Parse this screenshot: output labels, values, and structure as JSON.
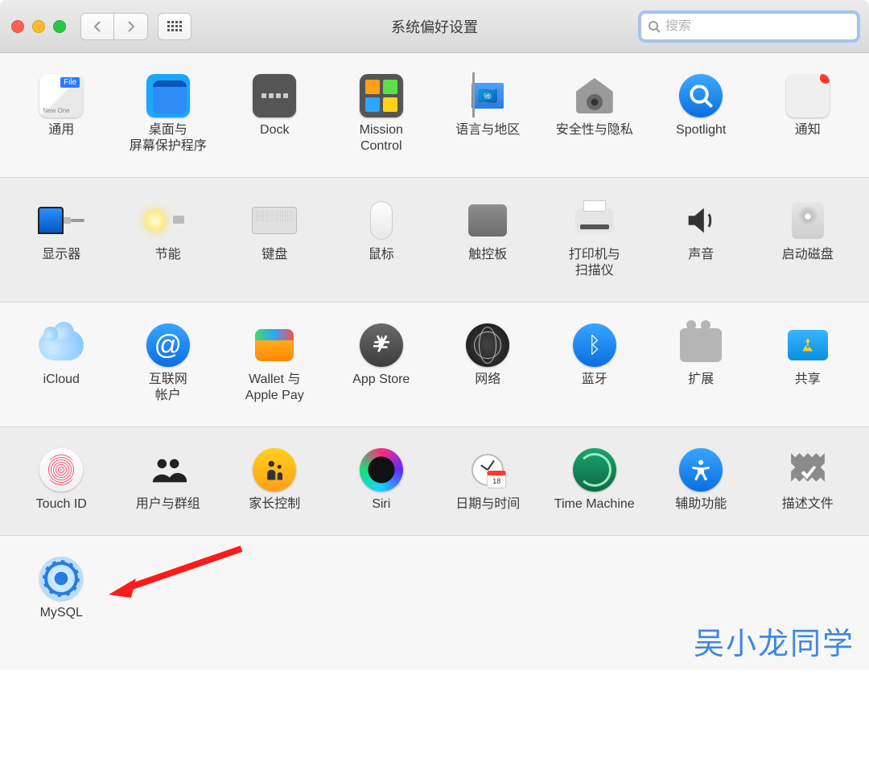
{
  "window": {
    "title": "系统偏好设置"
  },
  "search": {
    "placeholder": "搜索"
  },
  "rows": [
    {
      "items": [
        {
          "id": "general",
          "label": "通用"
        },
        {
          "id": "desktop",
          "label": "桌面与\n屏幕保护程序"
        },
        {
          "id": "dock",
          "label": "Dock"
        },
        {
          "id": "mission",
          "label": "Mission\nControl"
        },
        {
          "id": "language",
          "label": "语言与地区"
        },
        {
          "id": "security",
          "label": "安全性与隐私"
        },
        {
          "id": "spotlight",
          "label": "Spotlight"
        },
        {
          "id": "notifications",
          "label": "通知"
        }
      ]
    },
    {
      "items": [
        {
          "id": "displays",
          "label": "显示器"
        },
        {
          "id": "energy",
          "label": "节能"
        },
        {
          "id": "keyboard",
          "label": "键盘"
        },
        {
          "id": "mouse",
          "label": "鼠标"
        },
        {
          "id": "trackpad",
          "label": "触控板"
        },
        {
          "id": "printers",
          "label": "打印机与\n扫描仪"
        },
        {
          "id": "sound",
          "label": "声音"
        },
        {
          "id": "startup",
          "label": "启动磁盘"
        }
      ]
    },
    {
      "items": [
        {
          "id": "icloud",
          "label": "iCloud"
        },
        {
          "id": "internet",
          "label": "互联网\n帐户"
        },
        {
          "id": "wallet",
          "label": "Wallet 与\nApple Pay"
        },
        {
          "id": "appstore",
          "label": "App Store"
        },
        {
          "id": "network",
          "label": "网络"
        },
        {
          "id": "bluetooth",
          "label": "蓝牙"
        },
        {
          "id": "extensions",
          "label": "扩展"
        },
        {
          "id": "sharing",
          "label": "共享"
        }
      ]
    },
    {
      "items": [
        {
          "id": "touchid",
          "label": "Touch ID"
        },
        {
          "id": "users",
          "label": "用户与群组"
        },
        {
          "id": "parental",
          "label": "家长控制"
        },
        {
          "id": "siri",
          "label": "Siri"
        },
        {
          "id": "datetime",
          "label": "日期与时间"
        },
        {
          "id": "timemachine",
          "label": "Time Machine"
        },
        {
          "id": "accessibility",
          "label": "辅助功能"
        },
        {
          "id": "profiles",
          "label": "描述文件"
        }
      ]
    },
    {
      "items": [
        {
          "id": "mysql",
          "label": "MySQL"
        }
      ]
    }
  ],
  "general_tag": "File",
  "general_lines": "New\nOne",
  "cal_day": "18",
  "watermark": "吴小龙同学"
}
